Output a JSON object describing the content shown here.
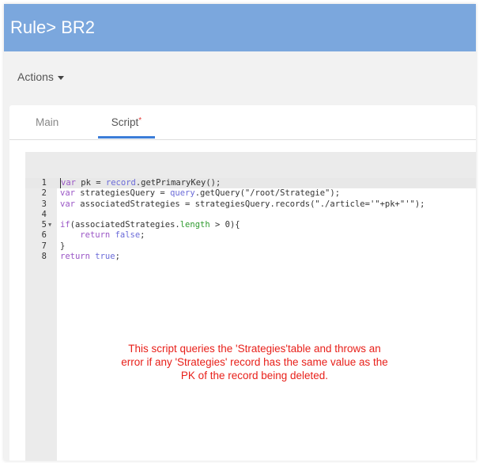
{
  "header": {
    "title": "Rule> BR2"
  },
  "toolbar": {
    "actions_label": "Actions"
  },
  "tabs": [
    {
      "label": "Main"
    },
    {
      "label": "Script",
      "modified_marker": "*",
      "active": true
    }
  ],
  "editor": {
    "lines": [
      {
        "n": "1",
        "code": "var pk = record.getPrimaryKey();"
      },
      {
        "n": "2",
        "code": "var strategiesQuery = query.getQuery(\"/root/Strategie\");"
      },
      {
        "n": "3",
        "code": "var associatedStrategies = strategiesQuery.records(\"./article='\"+pk+\"'\");"
      },
      {
        "n": "4",
        "code": ""
      },
      {
        "n": "5",
        "code": "if(associatedStrategies.length > 0){"
      },
      {
        "n": "6",
        "code": "    return false;"
      },
      {
        "n": "7",
        "code": "}"
      },
      {
        "n": "8",
        "code": "return true;"
      }
    ]
  },
  "annotation": "This script queries the 'Strategies'table and throws an error if any 'Strategies' record has the same value as the PK of the record being deleted.",
  "colors": {
    "header": "#7ba7dd",
    "tab_underline": "#3b7dd8",
    "annotation": "#e8201a"
  }
}
